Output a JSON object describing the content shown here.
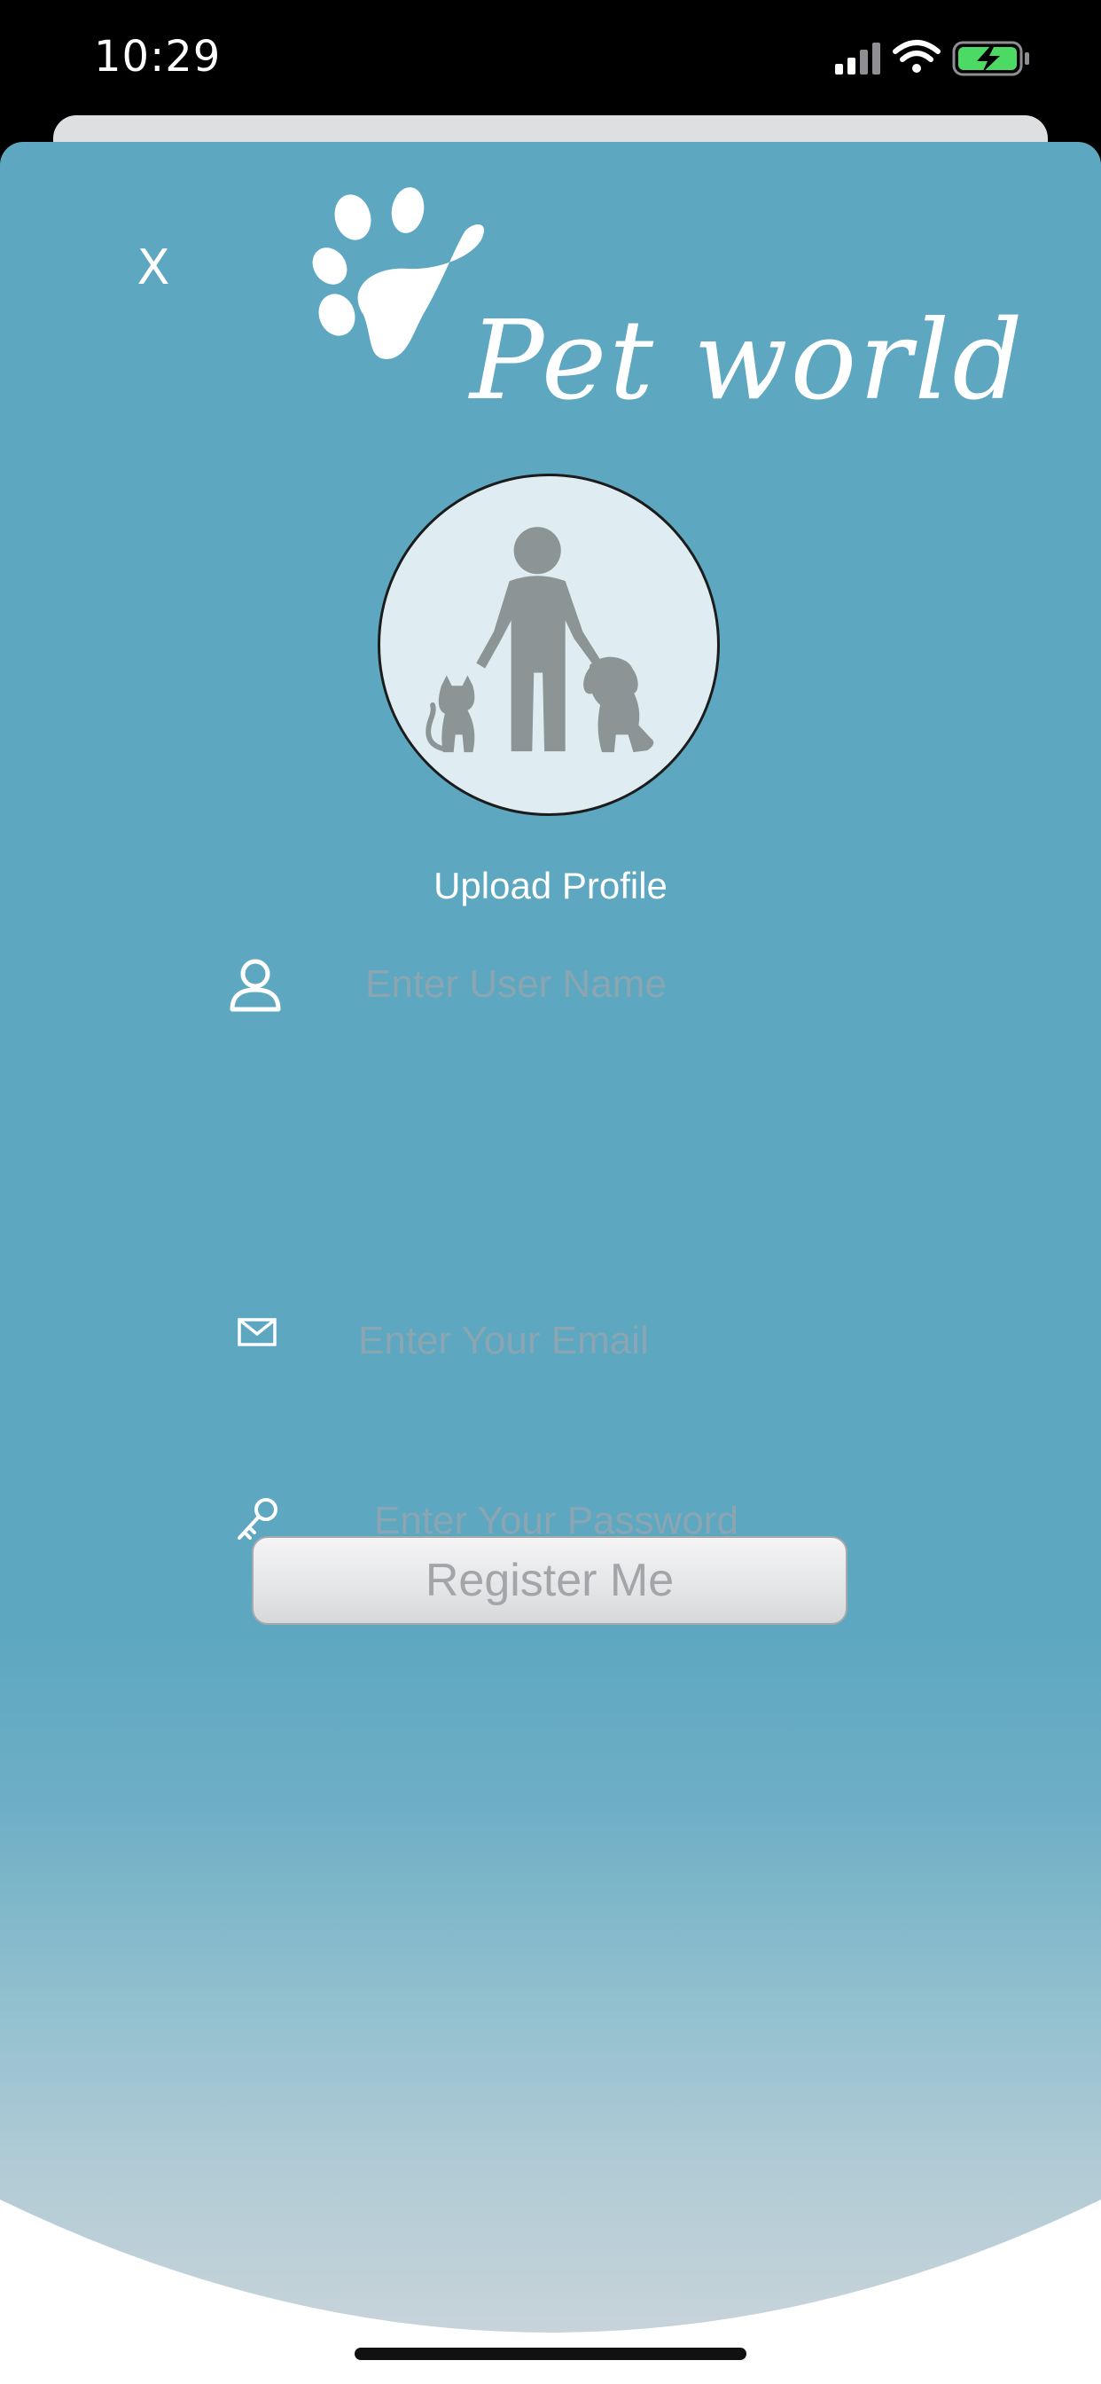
{
  "status_bar": {
    "time": "10:29"
  },
  "close": {
    "label": "X"
  },
  "brand": {
    "name": "Pet world"
  },
  "profile": {
    "upload_label": "Upload Profile"
  },
  "form": {
    "username": {
      "value": "",
      "placeholder": "Enter User Name",
      "icon": "user-icon"
    },
    "email": {
      "value": "",
      "placeholder": "Enter Your Email",
      "icon": "envelope-icon"
    },
    "password": {
      "value": "",
      "placeholder": "Enter Your Password",
      "icon": "key-icon"
    },
    "submit_label": "Register Me"
  },
  "colors": {
    "sheet_background": "#5da7c1",
    "sheet_bottom": "#cfd6db",
    "button_text": "#a3a5a8",
    "placeholder": "#8aa6b2",
    "battery_fill": "#4cd964"
  }
}
